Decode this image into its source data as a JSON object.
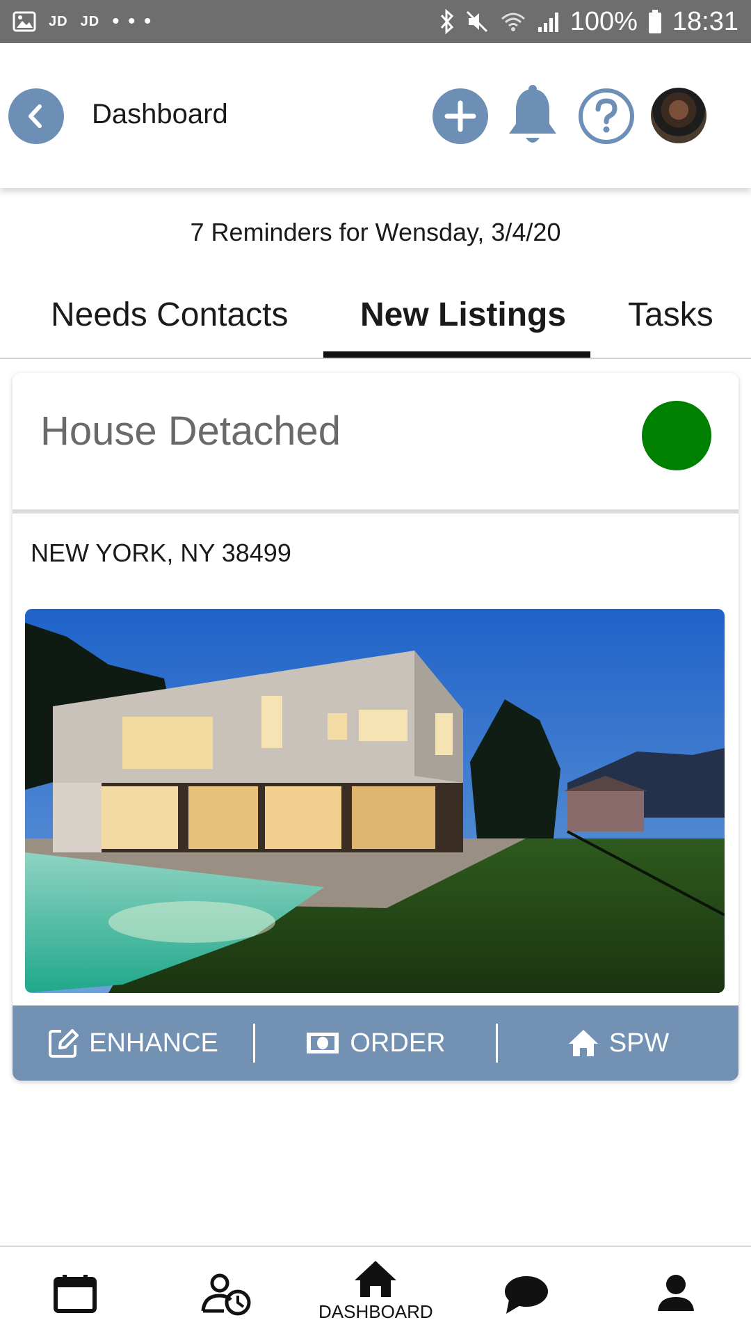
{
  "status_bar": {
    "carrier_1": "JD",
    "carrier_2": "JD",
    "dots": "• • •",
    "battery": "100%",
    "time": "18:31"
  },
  "header": {
    "title": "Dashboard"
  },
  "reminder": {
    "text": "7 Reminders for Wensday, 3/4/20"
  },
  "tabs": [
    {
      "label": "Needs Contacts",
      "active": false
    },
    {
      "label": "New Listings",
      "active": true
    },
    {
      "label": "Tasks",
      "active": false
    }
  ],
  "listing": {
    "title": "House Detached",
    "status_color": "#008000",
    "address": "NEW YORK, NY 38499"
  },
  "actions": {
    "enhance": "ENHANCE",
    "order": "ORDER",
    "spw": "SPW"
  },
  "bottom_nav": {
    "dashboard": "DASHBOARD"
  },
  "colors": {
    "accent": "#6e8fb5",
    "action_bar": "#7391b3",
    "status_bar": "#6e6e6e"
  }
}
